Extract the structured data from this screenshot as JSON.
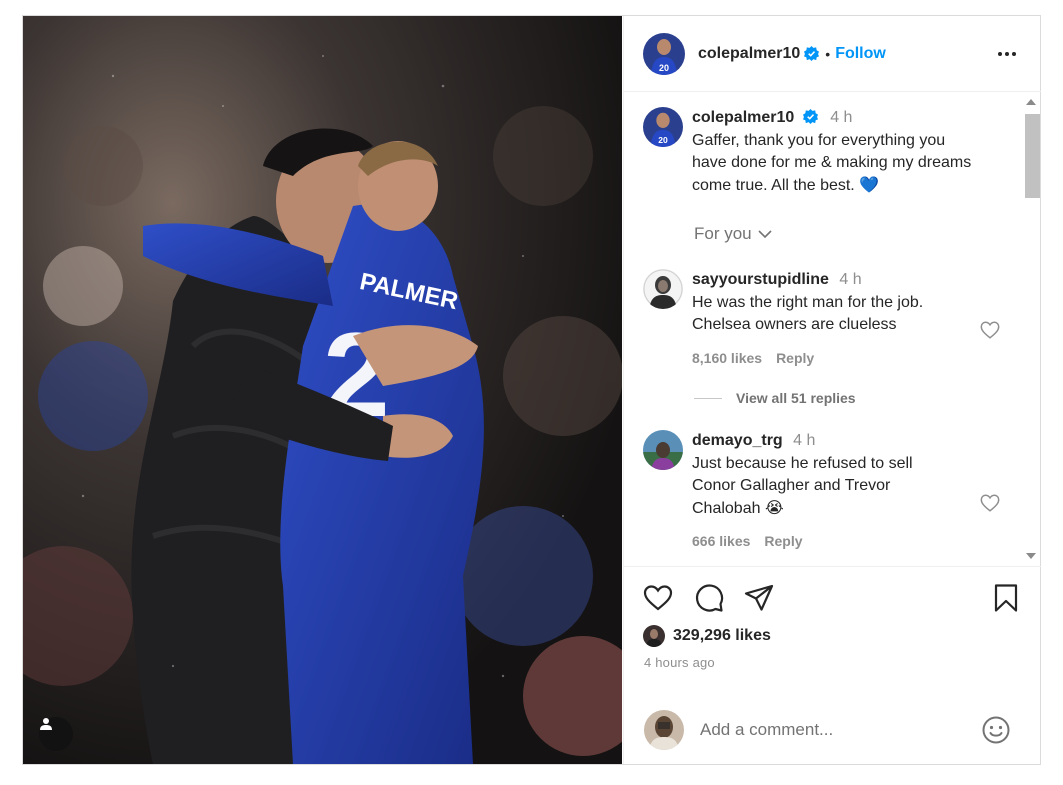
{
  "post": {
    "photo_alt": "",
    "author": "colepalmer10",
    "follow_label": "Follow",
    "dot": "•"
  },
  "caption": {
    "username": "colepalmer10",
    "time": "4 h",
    "text_lines": [
      "Gaffer, thank you for everything you",
      "have done for me & making my dreams",
      "come true. All the best. 💙"
    ]
  },
  "sort_label": "For you",
  "comments": [
    {
      "username": "sayyourstupidline",
      "time": "4 h",
      "text_lines": [
        "He was the right man for the job.",
        "Chelsea owners are clueless"
      ],
      "likes": "8,160 likes",
      "reply_label": "Reply"
    },
    {
      "username": "demayo_trg",
      "time": "4 h",
      "text_lines": [
        "Just because he refused to sell",
        "Conor Gallagher and Trevor",
        "Chalobah 😭"
      ],
      "likes": "666 likes",
      "reply_label": "Reply"
    }
  ],
  "view_replies_label": "View all 51 replies",
  "likes_count": "329,296 likes",
  "time_ago": "4 hours ago",
  "add_comment_placeholder": "Add a comment...",
  "icons": [
    "heart-icon",
    "comment-icon",
    "share-icon",
    "bookmark-icon",
    "emoji-icon",
    "more-icon",
    "verified-icon",
    "user-tag-icon"
  ],
  "colors": {
    "accent": "#0095f6",
    "text": "#262626",
    "muted": "#8e8e8e"
  }
}
